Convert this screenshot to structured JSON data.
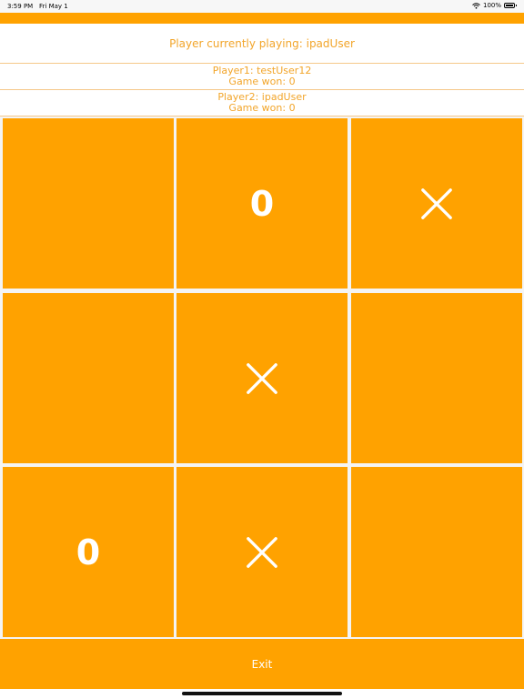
{
  "status_bar": {
    "time": "3:59 PM",
    "date": "Fri May 1",
    "battery_text": "100%",
    "battery_level": 1.0,
    "wifi_icon": "wifi-icon"
  },
  "colors": {
    "accent": "#ffa200",
    "text_accent": "#f2a52a",
    "mark": "#ffffff"
  },
  "game": {
    "current_player_text": "Player currently playing: ipadUser",
    "player1": {
      "name_line": "Player1: testUser12",
      "games_won_line": "Game won: 0"
    },
    "player2": {
      "name_line": "Player2: ipadUser",
      "games_won_line": "Game won: 0"
    },
    "board": [
      [
        "",
        "0",
        "X"
      ],
      [
        "",
        "X",
        ""
      ],
      [
        "0",
        "X",
        ""
      ]
    ]
  },
  "exit_label": "Exit"
}
